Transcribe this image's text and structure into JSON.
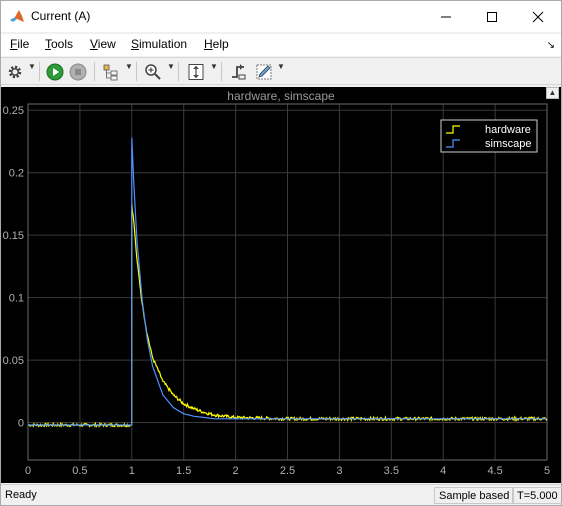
{
  "window": {
    "title": "Current (A)"
  },
  "menu": {
    "items": [
      "File",
      "Tools",
      "View",
      "Simulation",
      "Help"
    ]
  },
  "toolbar": {
    "buttons": [
      "settings-icon",
      "run-icon",
      "stop-icon",
      "signal-select-icon",
      "zoom-icon",
      "autoscale-icon",
      "trigger-icon",
      "style-icon"
    ]
  },
  "status": {
    "text": "Ready",
    "mode": "Sample based",
    "time": "T=5.000"
  },
  "colors": {
    "hardware": "#ffff00",
    "simscape": "#4d90ff",
    "grid": "#3a3a3a",
    "axes_bg": "#000000",
    "tick_text": "#b0b0b0"
  },
  "chart_data": {
    "type": "line",
    "title": "hardware, simscape",
    "xlabel": "",
    "ylabel": "",
    "xlim": [
      0,
      5
    ],
    "ylim": [
      -0.03,
      0.255
    ],
    "xticks": [
      "0",
      "0.5",
      "1",
      "1.5",
      "2",
      "2.5",
      "3",
      "3.5",
      "4",
      "4.5",
      "5"
    ],
    "yticks": [
      "0",
      "0.05",
      "0.1",
      "0.15",
      "0.2",
      "0.25"
    ],
    "grid": true,
    "legend_position": "top-right",
    "series": [
      {
        "name": "hardware",
        "x": [
          0,
          0.5,
          0.999,
          1.0,
          1.02,
          1.05,
          1.1,
          1.15,
          1.2,
          1.3,
          1.4,
          1.5,
          1.6,
          1.7,
          1.8,
          2.0,
          2.5,
          3.0,
          3.5,
          4.0,
          4.5,
          5.0
        ],
        "values": [
          -0.002,
          -0.002,
          -0.002,
          0.175,
          0.16,
          0.13,
          0.095,
          0.07,
          0.052,
          0.033,
          0.022,
          0.015,
          0.011,
          0.008,
          0.006,
          0.004,
          0.003,
          0.003,
          0.003,
          0.003,
          0.003,
          0.003
        ]
      },
      {
        "name": "simscape",
        "x": [
          0,
          0.5,
          0.999,
          1.0,
          1.02,
          1.05,
          1.1,
          1.15,
          1.2,
          1.3,
          1.4,
          1.5,
          1.6,
          1.7,
          1.8,
          2.0,
          2.5,
          3.0,
          3.5,
          4.0,
          4.5,
          5.0
        ],
        "values": [
          -0.002,
          -0.002,
          -0.002,
          0.228,
          0.19,
          0.145,
          0.098,
          0.066,
          0.045,
          0.022,
          0.012,
          0.007,
          0.005,
          0.004,
          0.003,
          0.003,
          0.003,
          0.003,
          0.003,
          0.003,
          0.003,
          0.003
        ]
      }
    ]
  }
}
